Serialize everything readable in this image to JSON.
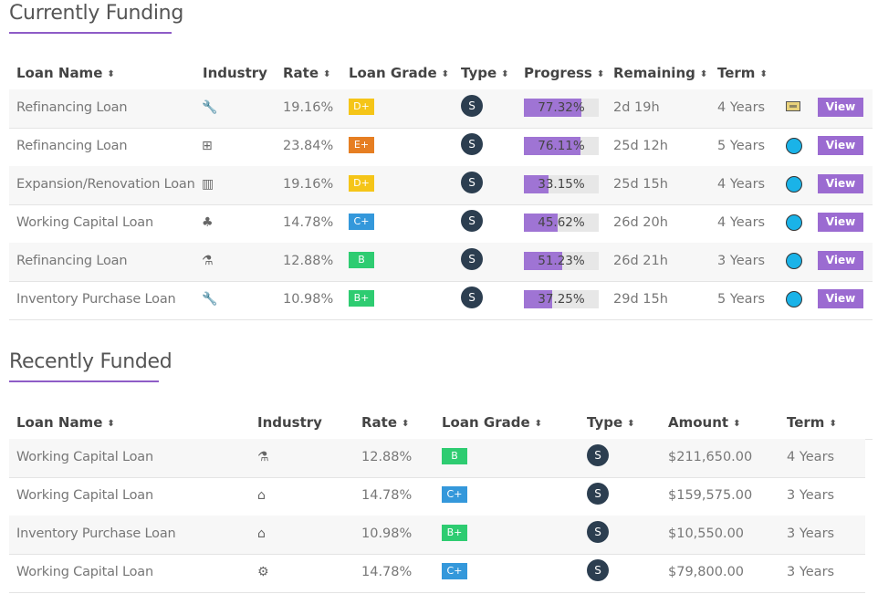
{
  "currently_funding": {
    "title": "Currently Funding",
    "headers": {
      "loan_name": "Loan Name",
      "industry": "Industry",
      "rate": "Rate",
      "loan_grade": "Loan Grade",
      "type": "Type",
      "progress": "Progress",
      "remaining": "Remaining",
      "term": "Term"
    },
    "view_label": "View",
    "rows": [
      {
        "name": "Refinancing Loan",
        "industry_icon": "wrench-icon",
        "rate": "19.16%",
        "grade": "D+",
        "grade_color": "#f5c518",
        "type": "S",
        "progress_value": 77.32,
        "progress": "77.32%",
        "remaining": "2d 19h",
        "term": "4 Years",
        "status_icon": "image-thumbnail-icon"
      },
      {
        "name": "Refinancing Loan",
        "industry_icon": "medical-kit-icon",
        "rate": "23.84%",
        "grade": "E+",
        "grade_color": "#e67e22",
        "type": "S",
        "progress_value": 76.11,
        "progress": "76.11%",
        "remaining": "25d 12h",
        "term": "5 Years",
        "status_icon": "blue-circle-icon"
      },
      {
        "name": "Expansion/Renovation Loan",
        "industry_icon": "building-icon",
        "rate": "19.16%",
        "grade": "D+",
        "grade_color": "#f5c518",
        "type": "S",
        "progress_value": 33.15,
        "progress": "33.15%",
        "remaining": "25d 15h",
        "term": "4 Years",
        "status_icon": "blue-circle-icon"
      },
      {
        "name": "Working Capital Loan",
        "industry_icon": "tree-icon",
        "rate": "14.78%",
        "grade": "C+",
        "grade_color": "#3498db",
        "type": "S",
        "progress_value": 45.62,
        "progress": "45.62%",
        "remaining": "26d 20h",
        "term": "4 Years",
        "status_icon": "blue-circle-icon"
      },
      {
        "name": "Refinancing Loan",
        "industry_icon": "flask-icon",
        "rate": "12.88%",
        "grade": "B",
        "grade_color": "#2ecc71",
        "type": "S",
        "progress_value": 51.23,
        "progress": "51.23%",
        "remaining": "26d 21h",
        "term": "3 Years",
        "status_icon": "blue-circle-icon"
      },
      {
        "name": "Inventory Purchase Loan",
        "industry_icon": "wrench-icon",
        "rate": "10.98%",
        "grade": "B+",
        "grade_color": "#2ecc71",
        "type": "S",
        "progress_value": 37.25,
        "progress": "37.25%",
        "remaining": "29d 15h",
        "term": "5 Years",
        "status_icon": "blue-circle-icon"
      }
    ]
  },
  "recently_funded": {
    "title": "Recently Funded",
    "headers": {
      "loan_name": "Loan Name",
      "industry": "Industry",
      "rate": "Rate",
      "loan_grade": "Loan Grade",
      "type": "Type",
      "amount": "Amount",
      "term": "Term"
    },
    "rows": [
      {
        "name": "Working Capital Loan",
        "industry_icon": "flask-icon",
        "rate": "12.88%",
        "grade": "B",
        "grade_color": "#2ecc71",
        "type": "S",
        "amount": "$211,650.00",
        "term": "4 Years"
      },
      {
        "name": "Working Capital Loan",
        "industry_icon": "shopping-basket-icon",
        "rate": "14.78%",
        "grade": "C+",
        "grade_color": "#3498db",
        "type": "S",
        "amount": "$159,575.00",
        "term": "3 Years"
      },
      {
        "name": "Inventory Purchase Loan",
        "industry_icon": "shopping-basket-icon",
        "rate": "10.98%",
        "grade": "B+",
        "grade_color": "#2ecc71",
        "type": "S",
        "amount": "$10,550.00",
        "term": "3 Years"
      },
      {
        "name": "Working Capital Loan",
        "industry_icon": "gears-icon",
        "rate": "14.78%",
        "grade": "C+",
        "grade_color": "#3498db",
        "type": "S",
        "amount": "$79,800.00",
        "term": "3 Years"
      }
    ]
  }
}
